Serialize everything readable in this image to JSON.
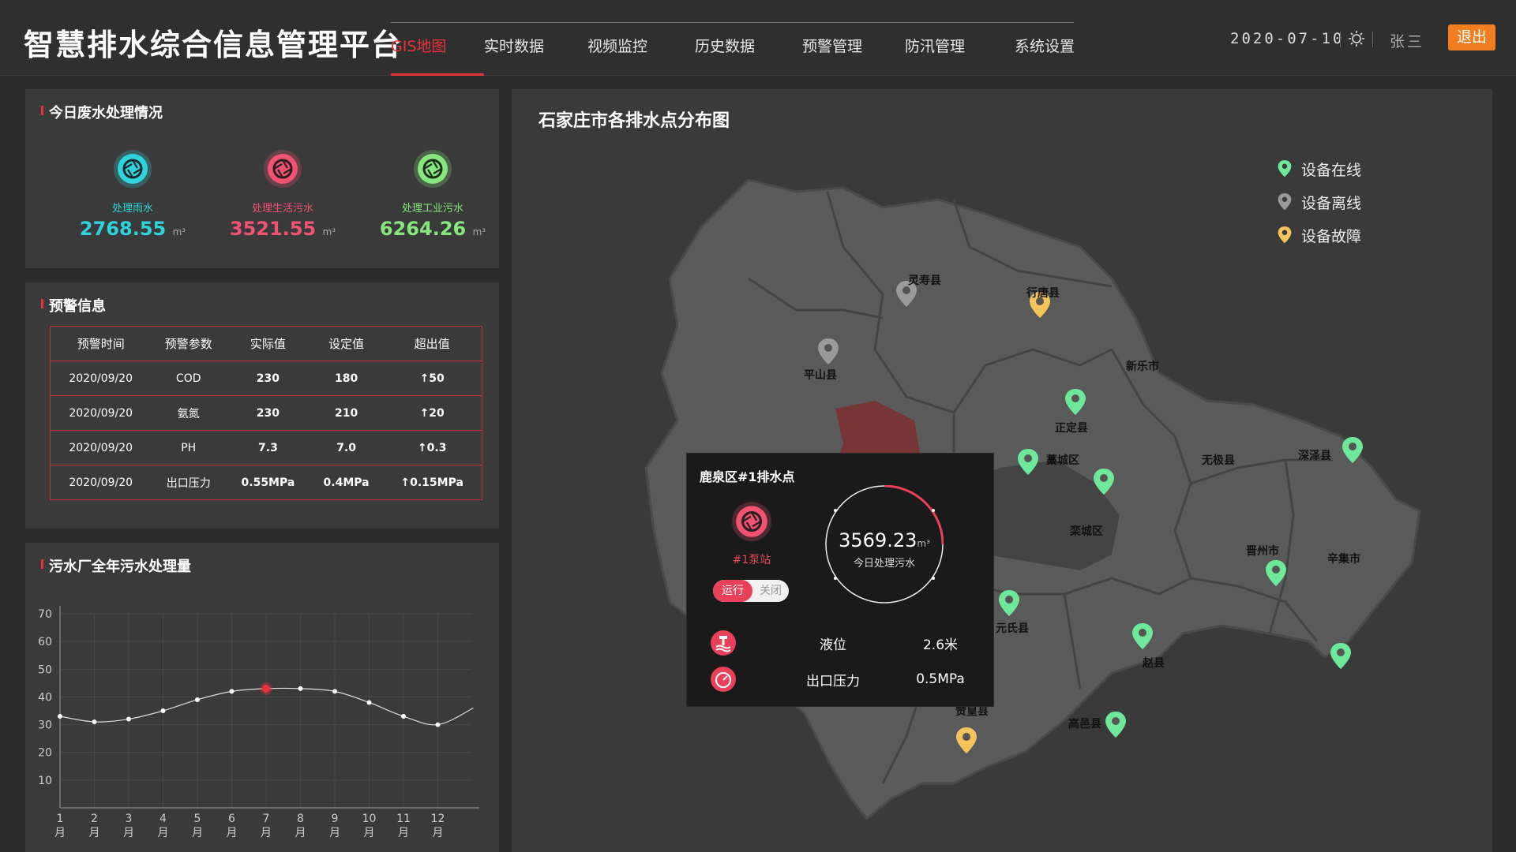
{
  "header": {
    "title": "智慧排水综合信息管理平台",
    "nav": [
      "GIS地图",
      "实时数据",
      "视频监控",
      "历史数据",
      "预警管理",
      "防汛管理",
      "系统设置"
    ],
    "date": "2020-07-10",
    "user": "张三",
    "logout": "退出"
  },
  "wastewater": {
    "title": "今日废水处理情况",
    "items": [
      {
        "label": "处理雨水",
        "value": "2768.55",
        "unit": "m³",
        "color": "#2fd3dc"
      },
      {
        "label": "处理生活污水",
        "value": "3521.55",
        "unit": "m³",
        "color": "#f25272"
      },
      {
        "label": "处理工业污水",
        "value": "6264.26",
        "unit": "m³",
        "color": "#86e87c"
      }
    ]
  },
  "warnings": {
    "title": "预警信息",
    "headers": [
      "预警时间",
      "预警参数",
      "实际值",
      "设定值",
      "超出值"
    ],
    "rows": [
      [
        "2020/09/20",
        "COD",
        "230",
        "180",
        "↑50"
      ],
      [
        "2020/09/20",
        "氨氮",
        "230",
        "210",
        "↑20"
      ],
      [
        "2020/09/20",
        "PH",
        "7.3",
        "7.0",
        "↑0.3"
      ],
      [
        "2020/09/20",
        "出口压力",
        "0.55MPa",
        "0.4MPa",
        "↑0.15MPa"
      ]
    ]
  },
  "annual": {
    "title": "污水厂全年污水处理量",
    "chart_data": {
      "type": "line",
      "x": [
        "1月",
        "2月",
        "3月",
        "4月",
        "5月",
        "6月",
        "7月",
        "8月",
        "9月",
        "10月",
        "11月",
        "12月"
      ],
      "values": [
        33,
        31,
        32,
        35,
        39,
        42,
        43,
        43,
        42,
        38,
        33,
        30
      ],
      "highlight_index": 6,
      "yticks": [
        10,
        20,
        30,
        40,
        50,
        60,
        70
      ],
      "ylim": [
        0,
        70
      ],
      "grid": true
    }
  },
  "map": {
    "title": "石家庄市各排水点分布图",
    "legend": [
      {
        "label": "设备在线",
        "color": "#6ee89a"
      },
      {
        "label": "设备离线",
        "color": "#9a9a9a"
      },
      {
        "label": "设备故障",
        "color": "#f5c45a"
      }
    ],
    "cities": [
      "灵寿县",
      "行唐县",
      "平山县",
      "新乐市",
      "正定县",
      "藁城区",
      "无极县",
      "深泽县",
      "辛集市",
      "晋州市",
      "赵县",
      "高邑县",
      "赞皇县",
      "元氏县",
      "栾城区"
    ],
    "popup": {
      "title": "鹿泉区#1排水点",
      "pump": "#1泵站",
      "toggle_on": "运行",
      "toggle_off": "关闭",
      "ring_value": "3569.23",
      "ring_unit": "m³",
      "ring_label": "今日处理污水",
      "rows": [
        {
          "label": "液位",
          "value": "2.6米"
        },
        {
          "label": "出口压力",
          "value": "0.5MPa"
        }
      ]
    }
  }
}
